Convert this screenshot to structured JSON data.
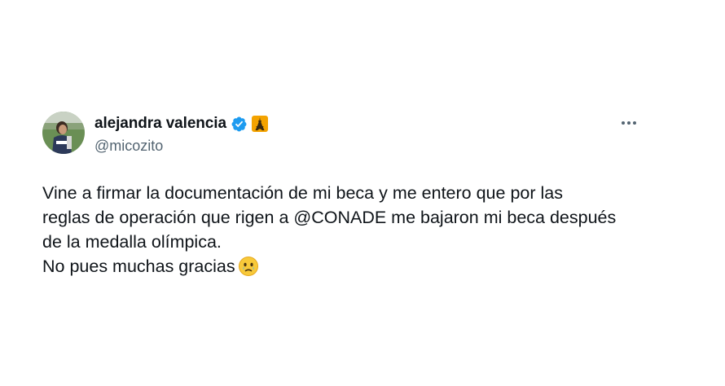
{
  "user": {
    "display_name": "alejandra valencia",
    "handle": "@micozito",
    "avatar_icon": "profile-photo",
    "verified_icon": "verified-badge-icon",
    "badge_icon": "eiffel-tower-icon"
  },
  "more_icon": "more-horizontal-icon",
  "tweet": {
    "lines": [
      "Vine a firmar la documentación de mi beca y me entero que por las",
      "reglas de operación que rigen a @CONADE me bajaron mi beca después",
      "de la medalla olímpica.",
      "No pues muchas gracias"
    ],
    "emoji": "face-holding-back-tears-icon"
  },
  "colors": {
    "text": "#0f1419",
    "secondary": "#536471",
    "verified": "#1d9bf0",
    "badge_bg": "#f4a300"
  }
}
